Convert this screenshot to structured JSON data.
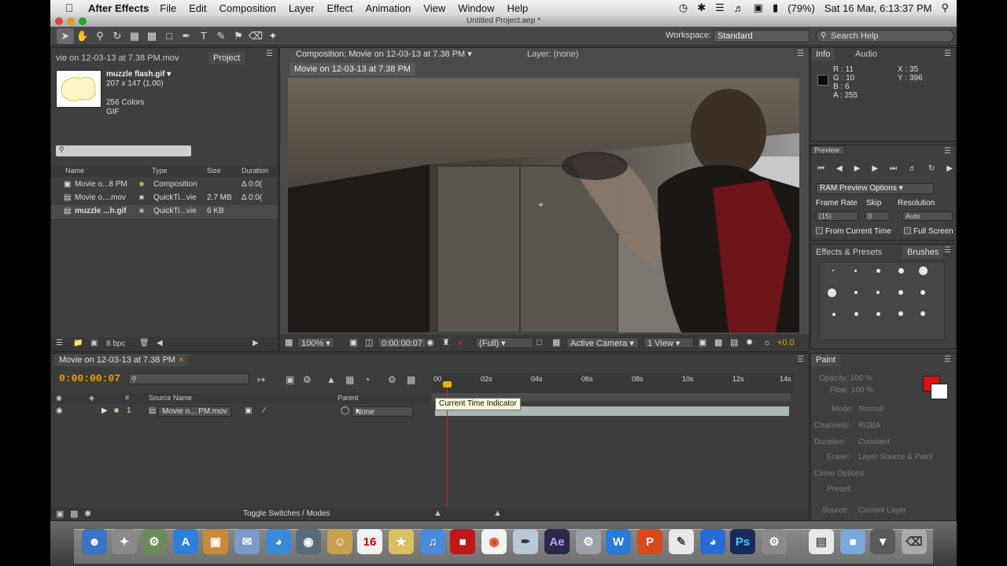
{
  "menubar": {
    "app_name": "After Effects",
    "items": [
      "File",
      "Edit",
      "Composition",
      "Layer",
      "Effect",
      "Animation",
      "View",
      "Window",
      "Help"
    ],
    "battery": "(79%)",
    "clock": "Sat 16 Mar, 6:13:37 PM"
  },
  "window": {
    "title": "Untitled Project.aep *"
  },
  "toolbar": {
    "workspace_label": "Workspace:",
    "workspace_value": "Standard",
    "search_placeholder": "Search Help"
  },
  "project": {
    "prev_tab": "vie on 12-03-13 at 7.38 PM.mov",
    "tab": "Project",
    "thumb_name": "muzzle flash.gif ▾",
    "thumb_dims": "207 x 147 (1.00)",
    "thumb_colors": "256 Colors",
    "thumb_type": "GIF",
    "columns": {
      "name": "Name",
      "type": "Type",
      "size": "Size",
      "duration": "Duration"
    },
    "items": [
      {
        "name": "Movie o...8 PM",
        "type": "Composition",
        "size": "",
        "duration": "Δ 0:0("
      },
      {
        "name": "Movie o....mov",
        "type": "QuickTi...vie",
        "size": "2.7 MB",
        "duration": "Δ 0:0("
      },
      {
        "name": "muzzle ...h.gif",
        "type": "QuickTi...vie",
        "size": "6 KB",
        "duration": ""
      }
    ],
    "bpc": "8 bpc"
  },
  "composition": {
    "tab": "Composition: Movie on 12-03-13 at 7.38 PM",
    "layer_tab": "Layer: (none)",
    "comp_name": "Movie on 12-03-13 at 7.38 PM",
    "zoom": "100%",
    "timecode": "0:00:00:07",
    "resolution": "(Full)",
    "camera": "Active Camera",
    "view": "1 View",
    "exposure": "+0.0"
  },
  "info": {
    "tab": "Info",
    "audio_tab": "Audio",
    "r": "R : 11",
    "g": "G : 10",
    "b": "B : 6",
    "a": "A : 255",
    "x": "X : 35",
    "y": "Y : 396"
  },
  "preview": {
    "tab": "Preview",
    "ram_options": "RAM Preview Options",
    "frame_rate_label": "Frame Rate",
    "skip_label": "Skip",
    "resolution_label": "Resolution",
    "frame_rate_value": "(15)",
    "skip_value": "0",
    "resolution_value": "Auto",
    "from_current": "From Current Time",
    "full_screen": "Full Screen"
  },
  "effects": {
    "tab": "Effects & Presets",
    "brushes_tab": "Brushes"
  },
  "timeline": {
    "tab": "Movie on 12-03-13 at 7.38 PM",
    "timecode": "0:00:00:07",
    "col_source": "Source Name",
    "col_parent": "Parent",
    "col_hash": "#",
    "layer_num": "1",
    "layer_name": "Movie o... PM.mov",
    "parent_value": "None",
    "ticks": [
      "00",
      "02s",
      "04s",
      "06s",
      "08s",
      "10s",
      "12s",
      "14s"
    ],
    "tooltip": "Current Time Indicator",
    "toggle": "Toggle Switches / Modes"
  },
  "paint": {
    "tab": "Paint",
    "opacity": "Opacity: 100 %",
    "flow": "Flow: 100 %",
    "mode": "Mode:",
    "mode_value": "Normal",
    "channels": "Channels:",
    "channels_value": "RGBA",
    "duration": "Duration:",
    "duration_value": "Constant",
    "erase": "Erase:",
    "erase_value": "Layer Source & Paint",
    "clone": "Clone Options",
    "preset": "Preset:",
    "source": "Source:",
    "source_value": "Current Layer"
  },
  "dock": {
    "calendar_day": "16"
  }
}
